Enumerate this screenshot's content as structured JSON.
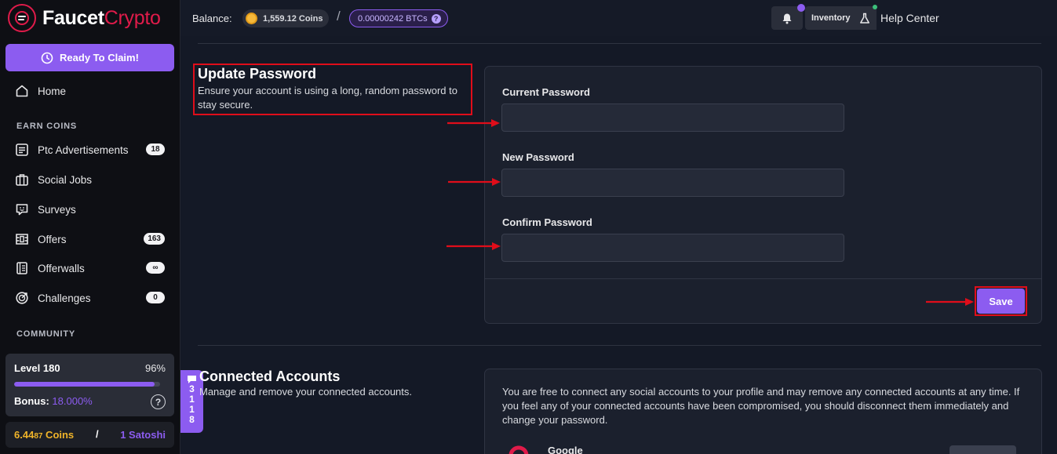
{
  "brand": {
    "name_part1": "Faucet",
    "name_part2": "Crypto"
  },
  "sidebar": {
    "claim_label": "Ready To Claim!",
    "home_label": "Home",
    "earn_section": "EARN COINS",
    "items": [
      {
        "label": "Ptc Advertisements",
        "badge": "18",
        "icon": "list-icon"
      },
      {
        "label": "Social Jobs",
        "badge": "",
        "icon": "briefcase-icon"
      },
      {
        "label": "Surveys",
        "badge": "",
        "icon": "chat-smile-icon"
      },
      {
        "label": "Offers",
        "badge": "163",
        "icon": "offers-icon"
      },
      {
        "label": "Offerwalls",
        "badge": "∞",
        "icon": "book-icon"
      },
      {
        "label": "Challenges",
        "badge": "0",
        "icon": "target-icon"
      }
    ],
    "community_section": "COMMUNITY",
    "level": {
      "label": "Level 180",
      "percent_text": "96%",
      "progress": 0.96,
      "bonus_label": "Bonus:",
      "bonus_value": "18.000%"
    },
    "coins": {
      "main": "6.44",
      "small": "87",
      "unit": " Coins",
      "separator": "/",
      "satoshi": "1 Satoshi"
    },
    "chat_count": [
      "3",
      "1",
      "1",
      "8"
    ]
  },
  "topbar": {
    "balance_label": "Balance:",
    "coins": "1,559.12 Coins",
    "separator": "/",
    "btc": "0.00000242 BTCs",
    "help_center": "Help Center",
    "inventory": "Inventory"
  },
  "update_password": {
    "title": "Update Password",
    "description": "Ensure your account is using a long, random password to stay secure.",
    "fields": [
      {
        "label": "Current Password",
        "value": "",
        "placeholder": ""
      },
      {
        "label": "New Password",
        "value": "",
        "placeholder": ""
      },
      {
        "label": "Confirm Password",
        "value": "",
        "placeholder": ""
      }
    ],
    "save_label": "Save"
  },
  "connected_accounts": {
    "title": "Connected Accounts",
    "description": "Manage and remove your connected accounts.",
    "info": "You are free to connect any social accounts to your profile and may remove any connected accounts at any time. If you feel any of your connected accounts have been compromised, you should disconnect them immediately and change your password.",
    "provider": "Google"
  },
  "colors": {
    "accent": "#8c5cf0",
    "brand_red": "#e01b4a",
    "annotation_red": "#e00d1a",
    "coin": "#f0b429"
  }
}
